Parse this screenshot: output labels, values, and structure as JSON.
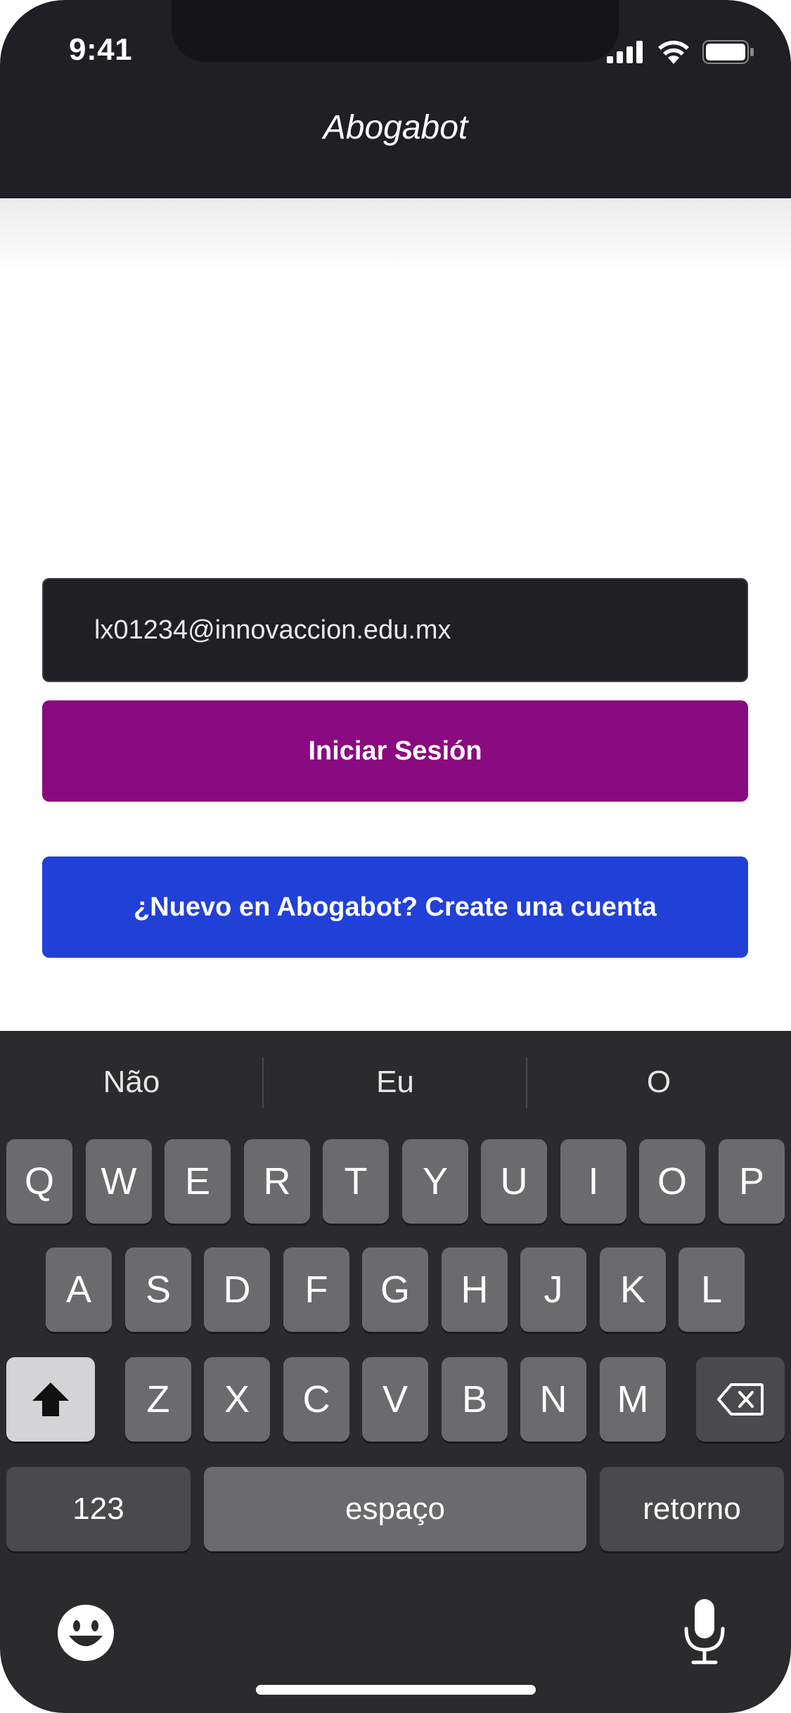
{
  "status_bar": {
    "time": "9:41"
  },
  "header": {
    "title": "Abogabot"
  },
  "form": {
    "email_value": "lx01234@innovaccion.edu.mx",
    "login_label": "Iniciar Sesión",
    "signup_label": "¿Nuevo en Abogabot? Create una cuenta"
  },
  "keyboard": {
    "suggestions": [
      "Não",
      "Eu",
      "O"
    ],
    "row1": [
      "Q",
      "W",
      "E",
      "R",
      "T",
      "Y",
      "U",
      "I",
      "O",
      "P"
    ],
    "row2": [
      "A",
      "S",
      "D",
      "F",
      "G",
      "H",
      "J",
      "K",
      "L"
    ],
    "row3": [
      "Z",
      "X",
      "C",
      "V",
      "B",
      "N",
      "M"
    ],
    "numbers_label": "123",
    "space_label": "espaço",
    "return_label": "retorno"
  },
  "icons": {
    "signal": "cellular-signal-icon",
    "wifi": "wifi-icon",
    "battery": "battery-icon",
    "shift": "shift-icon",
    "delete": "backspace-icon",
    "emoji": "emoji-icon",
    "mic": "microphone-icon"
  },
  "colors": {
    "header_bg": "#1f1f24",
    "login_button": "#8a0a80",
    "signup_button": "#2140d8",
    "keyboard_bg": "#2b2b2d",
    "key_bg": "#6b6b6d"
  }
}
